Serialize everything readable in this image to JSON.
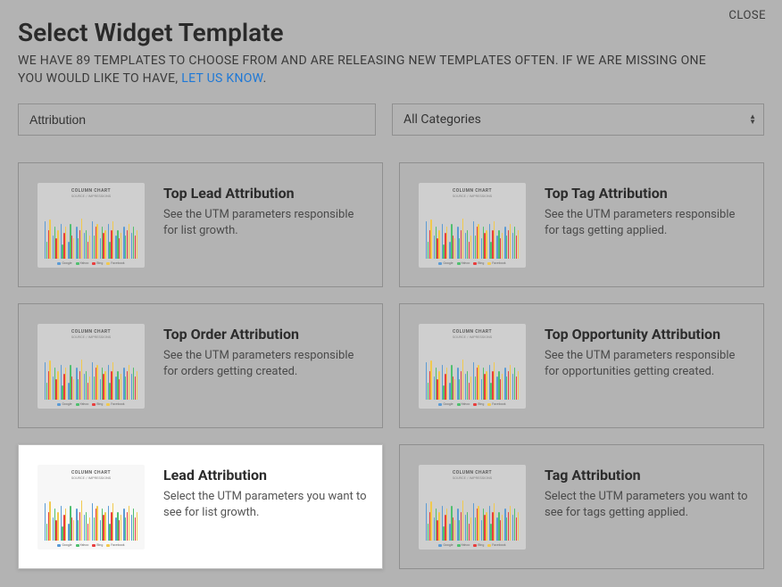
{
  "close": "CLOSE",
  "title": "Select Widget Template",
  "subtitle_prefix": "WE HAVE 89 TEMPLATES TO CHOOSE FROM AND ARE RELEASING NEW TEMPLATES OFTEN. IF WE ARE MISSING ONE YOU WOULD LIKE TO HAVE, ",
  "subtitle_link": "LET US KNOW",
  "subtitle_suffix": ".",
  "search": {
    "value": "Attribution"
  },
  "category": {
    "value": "All Categories"
  },
  "thumb": {
    "title": "COLUMN CHART",
    "subtitle": "SOURCE / IMPRESSIONS",
    "legend": [
      {
        "label": "Google",
        "color": "#5b9bd5"
      },
      {
        "label": "Yahoo",
        "color": "#4fbf6e"
      },
      {
        "label": "Bing",
        "color": "#e83e3e"
      },
      {
        "label": "Facebook",
        "color": "#f2c94c"
      }
    ],
    "bars": [
      [
        65,
        30,
        50,
        68
      ],
      [
        40,
        55,
        35,
        50
      ],
      [
        60,
        25,
        45,
        55
      ],
      [
        30,
        60,
        40,
        35
      ],
      [
        55,
        35,
        50,
        70
      ],
      [
        45,
        50,
        30,
        40
      ],
      [
        65,
        40,
        55,
        60
      ],
      [
        35,
        55,
        45,
        50
      ],
      [
        60,
        30,
        50,
        65
      ],
      [
        40,
        50,
        35,
        45
      ],
      [
        55,
        40,
        50,
        60
      ],
      [
        45,
        55,
        40,
        50
      ]
    ]
  },
  "cards": [
    {
      "title": "Top Lead Attribution",
      "desc": "See the UTM parameters responsible for list growth.",
      "selected": false
    },
    {
      "title": "Top Tag Attribution",
      "desc": "See the UTM parameters responsible for tags getting applied.",
      "selected": false
    },
    {
      "title": "Top Order Attribution",
      "desc": "See the UTM parameters responsible for orders getting created.",
      "selected": false
    },
    {
      "title": "Top Opportunity Attribution",
      "desc": "See the UTM parameters responsible for opportunities getting created.",
      "selected": false
    },
    {
      "title": "Lead Attribution",
      "desc": "Select the UTM parameters you want to see for list growth.",
      "selected": true
    },
    {
      "title": "Tag Attribution",
      "desc": "Select the UTM parameters you want to see for tags getting applied.",
      "selected": false
    }
  ]
}
